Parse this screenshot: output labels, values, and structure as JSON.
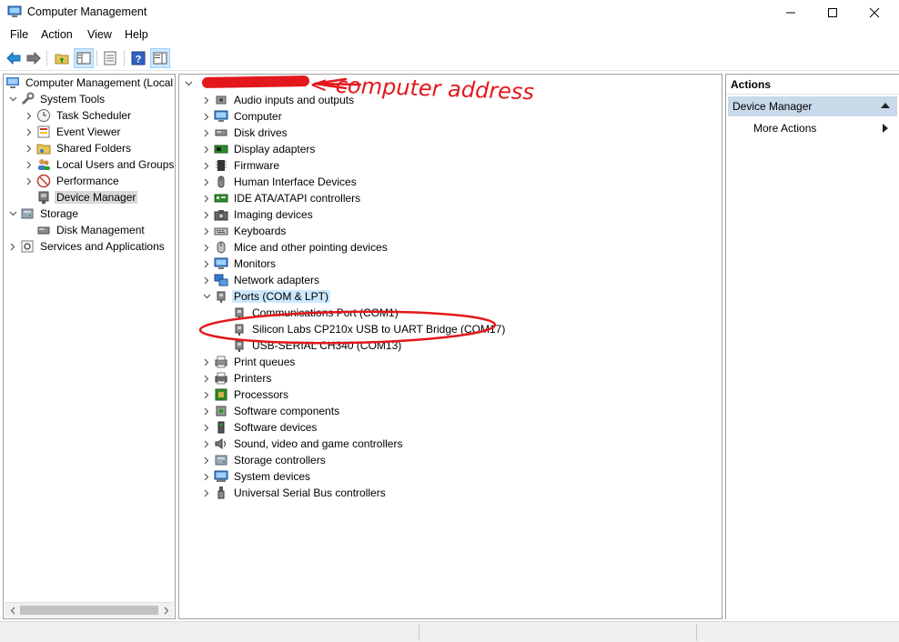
{
  "window": {
    "title": "Computer Management",
    "minimize_icon": "minimize-icon",
    "maximize_icon": "maximize-icon",
    "close_icon": "close-icon"
  },
  "menu": [
    {
      "label": "File"
    },
    {
      "label": "Action"
    },
    {
      "label": "View"
    },
    {
      "label": "Help"
    }
  ],
  "toolbar": {
    "buttons": [
      "back-arrow-icon",
      "forward-arrow-icon",
      "up-folder-icon",
      "show-hide-tree-icon",
      "properties-icon",
      "help-icon",
      "show-action-pane-icon"
    ]
  },
  "left_tree": {
    "root": "Computer Management (Local",
    "system_tools": "System Tools",
    "items": [
      {
        "label": "Task Scheduler",
        "icon": "clock-icon"
      },
      {
        "label": "Event Viewer",
        "icon": "event-viewer-icon"
      },
      {
        "label": "Shared Folders",
        "icon": "shared-folder-icon"
      },
      {
        "label": "Local Users and Groups",
        "icon": "users-icon"
      },
      {
        "label": "Performance",
        "icon": "performance-icon"
      },
      {
        "label": "Device Manager",
        "icon": "device-manager-icon"
      }
    ],
    "storage": "Storage",
    "disk_management": "Disk Management",
    "services": "Services and Applications"
  },
  "devices": {
    "categories_top": [
      {
        "label": "Audio inputs and outputs",
        "icon": "speaker-icon"
      },
      {
        "label": "Computer",
        "icon": "monitor-icon"
      },
      {
        "label": "Disk drives",
        "icon": "disk-drive-icon"
      },
      {
        "label": "Display adapters",
        "icon": "display-adapter-icon"
      },
      {
        "label": "Firmware",
        "icon": "chip-icon"
      },
      {
        "label": "Human Interface Devices",
        "icon": "hid-icon"
      },
      {
        "label": "IDE ATA/ATAPI controllers",
        "icon": "ide-controller-icon"
      },
      {
        "label": "Imaging devices",
        "icon": "camera-icon"
      },
      {
        "label": "Keyboards",
        "icon": "keyboard-icon"
      },
      {
        "label": "Mice and other pointing devices",
        "icon": "mouse-icon"
      },
      {
        "label": "Monitors",
        "icon": "monitor-icon"
      },
      {
        "label": "Network adapters",
        "icon": "network-icon"
      }
    ],
    "ports_label": "Ports (COM & LPT)",
    "ports_children": [
      {
        "label": "Communications Port (COM1)"
      },
      {
        "label": "Silicon Labs CP210x USB to UART Bridge (COM17)"
      },
      {
        "label": "USB-SERIAL CH340 (COM13)"
      }
    ],
    "categories_bottom": [
      {
        "label": "Print queues",
        "icon": "print-queue-icon"
      },
      {
        "label": "Printers",
        "icon": "printer-icon"
      },
      {
        "label": "Processors",
        "icon": "processor-icon"
      },
      {
        "label": "Software components",
        "icon": "software-component-icon"
      },
      {
        "label": "Software devices",
        "icon": "software-device-icon"
      },
      {
        "label": "Sound, video and game controllers",
        "icon": "sound-icon"
      },
      {
        "label": "Storage controllers",
        "icon": "storage-controller-icon"
      },
      {
        "label": "System devices",
        "icon": "system-device-icon"
      },
      {
        "label": "Universal Serial Bus controllers",
        "icon": "usb-icon"
      }
    ]
  },
  "actions": {
    "header": "Actions",
    "section": "Device Manager",
    "more": "More Actions"
  },
  "annotation": {
    "text": "<-computer address",
    "color": "#e2181d"
  }
}
